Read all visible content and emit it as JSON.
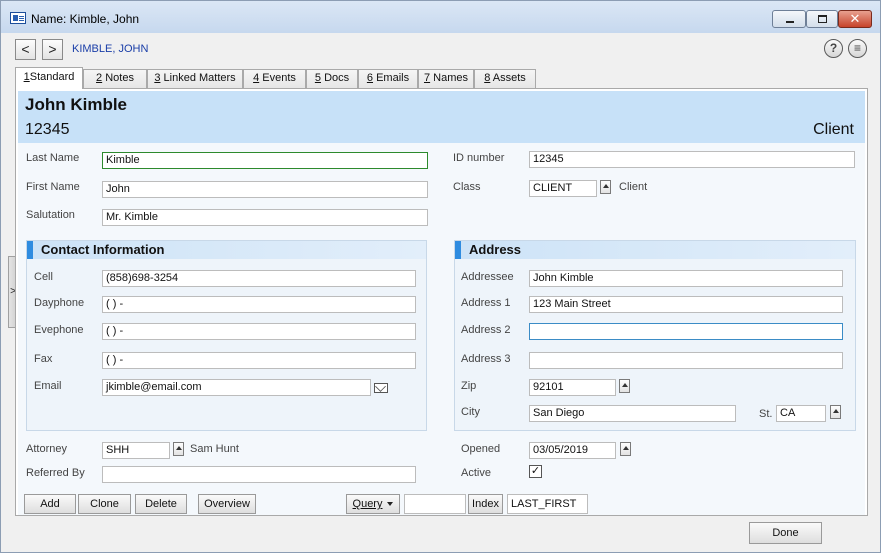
{
  "window": {
    "title": "Name: Kimble, John",
    "breadcrumb": "KIMBLE, JOHN"
  },
  "tabs": [
    {
      "num": "1",
      "label": "Standard"
    },
    {
      "num": "2",
      "label": "Notes"
    },
    {
      "num": "3",
      "label": "Linked Matters"
    },
    {
      "num": "4",
      "label": "Events"
    },
    {
      "num": "5",
      "label": "Docs"
    },
    {
      "num": "6",
      "label": "Emails"
    },
    {
      "num": "7",
      "label": "Names"
    },
    {
      "num": "8",
      "label": "Assets"
    }
  ],
  "header": {
    "full_name": "John Kimble",
    "id": "12345",
    "class_label": "Client"
  },
  "general": {
    "last_name_label": "Last Name",
    "last_name": "Kimble",
    "first_name_label": "First Name",
    "first_name": "John",
    "salutation_label": "Salutation",
    "salutation": "Mr. Kimble",
    "id_label": "ID number",
    "id_value": "12345",
    "class_label": "Class",
    "class_value": "CLIENT",
    "class_desc": "Client"
  },
  "contact": {
    "title": "Contact Information",
    "cell_label": "Cell",
    "cell": "(858)698-3254",
    "dayphone_label": "Dayphone",
    "dayphone": "(  )  -",
    "evephone_label": "Evephone",
    "evephone": "(  )  -",
    "fax_label": "Fax",
    "fax": "(  )  -",
    "email_label": "Email",
    "email": "jkimble@email.com"
  },
  "address": {
    "title": "Address",
    "addressee_label": "Addressee",
    "addressee": "John Kimble",
    "address1_label": "Address 1",
    "address1": "123 Main Street",
    "address2_label": "Address 2",
    "address2": "",
    "address3_label": "Address 3",
    "address3": "",
    "zip_label": "Zip",
    "zip": "92101",
    "city_label": "City",
    "city": "San Diego",
    "state_label": "St.",
    "state": "CA"
  },
  "misc": {
    "attorney_label": "Attorney",
    "attorney": "SHH",
    "attorney_name": "Sam Hunt",
    "referred_label": "Referred By",
    "referred": "",
    "opened_label": "Opened",
    "opened": "03/05/2019",
    "active_label": "Active",
    "active_mark": "✓"
  },
  "toolbar": {
    "add": "Add",
    "clone": "Clone",
    "delete": "Delete",
    "overview": "Overview",
    "query": "Query",
    "query_value": "",
    "index": "Index",
    "index_value": "LAST_FIRST"
  },
  "footer": {
    "done": "Done",
    "side_handle": ">"
  },
  "icons": {
    "help": "?",
    "menu": "≡",
    "back": "<",
    "forward": ">"
  }
}
